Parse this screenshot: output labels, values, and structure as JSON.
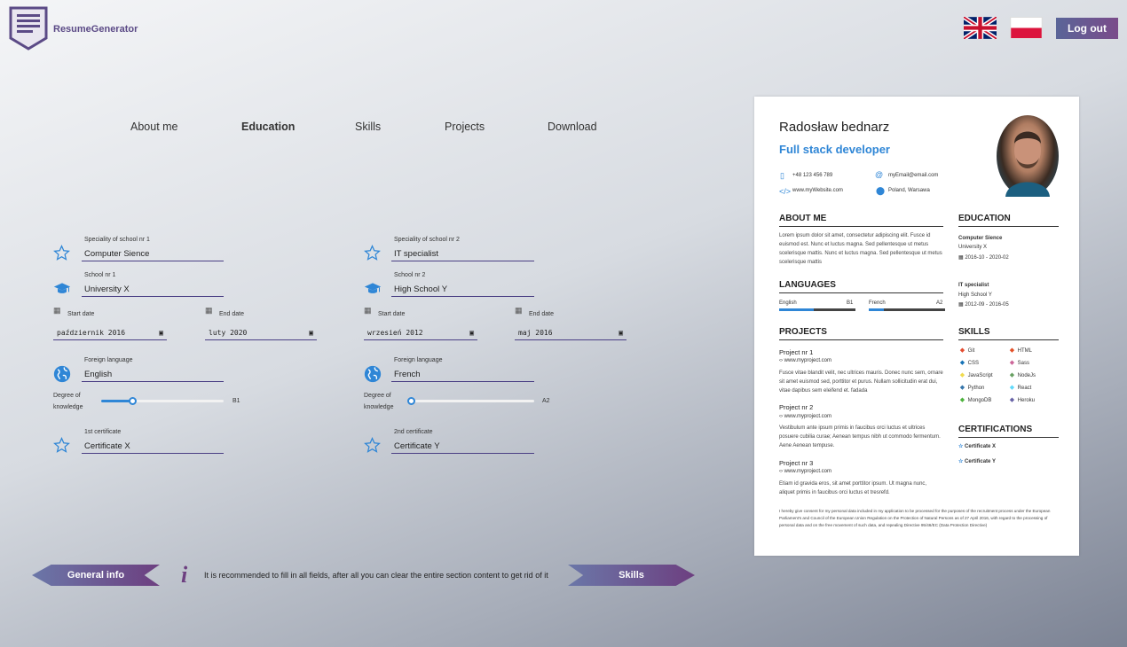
{
  "header": {
    "brand": "ResumeGenerator",
    "logout_label": "Log out"
  },
  "tabs": [
    "About me",
    "Education",
    "Skills",
    "Projects",
    "Download"
  ],
  "active_tab": "Education",
  "school1": {
    "speciality_label": "Speciality of school nr 1",
    "speciality_value": "Computer Sience",
    "school_label": "School nr 1",
    "school_value": "University X",
    "start_label": "Start date",
    "start_value": "październik 2016",
    "end_label": "End date",
    "end_value": "luty 2020",
    "language_label": "Foreign language",
    "language_value": "English",
    "degree_label_1": "Degree of",
    "degree_label_2": "knowledge",
    "degree_value": "B1",
    "degree_level": 0.25,
    "certificate_label": "1st certificate",
    "certificate_value": "Certificate X"
  },
  "school2": {
    "speciality_label": "Speciality of school nr 2",
    "speciality_value": "IT specialist",
    "school_label": "School nr 2",
    "school_value": "High School Y",
    "start_label": "Start date",
    "start_value": "wrzesień 2012",
    "end_label": "End date",
    "end_value": "maj 2016",
    "language_label": "Foreign language",
    "language_value": "French",
    "degree_label_1": "Degree of",
    "degree_label_2": "knowledge",
    "degree_value": "A2",
    "degree_level": 0.0,
    "certificate_label": "2nd certificate",
    "certificate_value": "Certificate Y"
  },
  "bottom": {
    "prev_label": "General info",
    "next_label": "Skills",
    "info_text": "It is recommended to fill in all fields, after all you can clear the entire section content to get rid of it"
  },
  "resume": {
    "name": "Radosław bednarz",
    "role": "Full stack developer",
    "phone": "+48 123 456 789",
    "email": "myEmail@email.com",
    "website": "www.myWebsite.com",
    "location": "Poland, Warsawa",
    "about_title": "ABOUT ME",
    "about_text": "Lorem ipsum dolor sit amet, consectetur adipiscing elit. Fusce id euismod est. Nunc et luctus magna. Sed pellentesque ut metus scelerisque mattis. Nunc et luctus magna. Sed pellentesque ut metus scelerisque mattis",
    "education_title": "EDUCATION",
    "education": [
      {
        "speciality": "Computer Sience",
        "school": "University X",
        "dates": "2016-10 - 2020-02"
      },
      {
        "speciality": "IT specialist",
        "school": "High School Y",
        "dates": "2012-09 - 2016-05"
      }
    ],
    "languages_title": "LANGUAGES",
    "languages": [
      {
        "name": "English",
        "level": "B1",
        "fill": 0.45
      },
      {
        "name": "French",
        "level": "A2",
        "fill": 0.2
      }
    ],
    "projects_title": "PROJECTS",
    "projects": [
      {
        "name": "Project nr 1",
        "url": "www.myproject.com",
        "desc": "Fusce vitae blandit velit, nec ultrices mauris. Donec nunc sem, ornare sit amet euismod sed, porttitor et purus. Nullam sollicitudin erat dui, vitae dapibus sem eleifend et. fadada"
      },
      {
        "name": "Project nr 2",
        "url": "www.myproject.com",
        "desc": "Vestibulum ante ipsum primis in faucibus orci luctus et ultrices posuere cubilia curae; Aenean tempus nibh ut commodo fermentum. Aene Aenean tempuse."
      },
      {
        "name": "Project nr 3",
        "url": "www.myproject.com",
        "desc": "Etiam id gravida eros, sit amet porttitor ipsum. Ut magna nunc, aliquet primis in faucibus orci luctus et tresrefd."
      }
    ],
    "skills_title": "SKILLS",
    "skills": [
      {
        "name": "Git",
        "icon": "git-icon",
        "color": "#e44c30"
      },
      {
        "name": "HTML",
        "icon": "html-icon",
        "color": "#e34f26"
      },
      {
        "name": "CSS",
        "icon": "css-icon",
        "color": "#1572b6"
      },
      {
        "name": "Sass",
        "icon": "sass-icon",
        "color": "#cc6699"
      },
      {
        "name": "JavaScript",
        "icon": "javascript-icon",
        "color": "#f0db4f"
      },
      {
        "name": "NodeJs",
        "icon": "nodejs-icon",
        "color": "#68a063"
      },
      {
        "name": "Python",
        "icon": "python-icon",
        "color": "#3776ab"
      },
      {
        "name": "React",
        "icon": "react-icon",
        "color": "#61dafb"
      },
      {
        "name": "MongoDB",
        "icon": "mongodb-icon",
        "color": "#4db33d"
      },
      {
        "name": "Heroku",
        "icon": "heroku-icon",
        "color": "#6762a6"
      }
    ],
    "certifications_title": "CERTIFICATIONS",
    "certifications": [
      "Certificate X",
      "Certificate Y"
    ],
    "consent": "I hereby give consent for my personal data included in my application to be processed for the purposes of the recruitment process under the European Parliament's and Council of the European Union Regulation on the Protection of Natural Persons as of 27 April 2016, with regard to the processing of personal data and on the free movement of such data, and repealing Directive 95/46/EC (Data Protection Directive)"
  }
}
